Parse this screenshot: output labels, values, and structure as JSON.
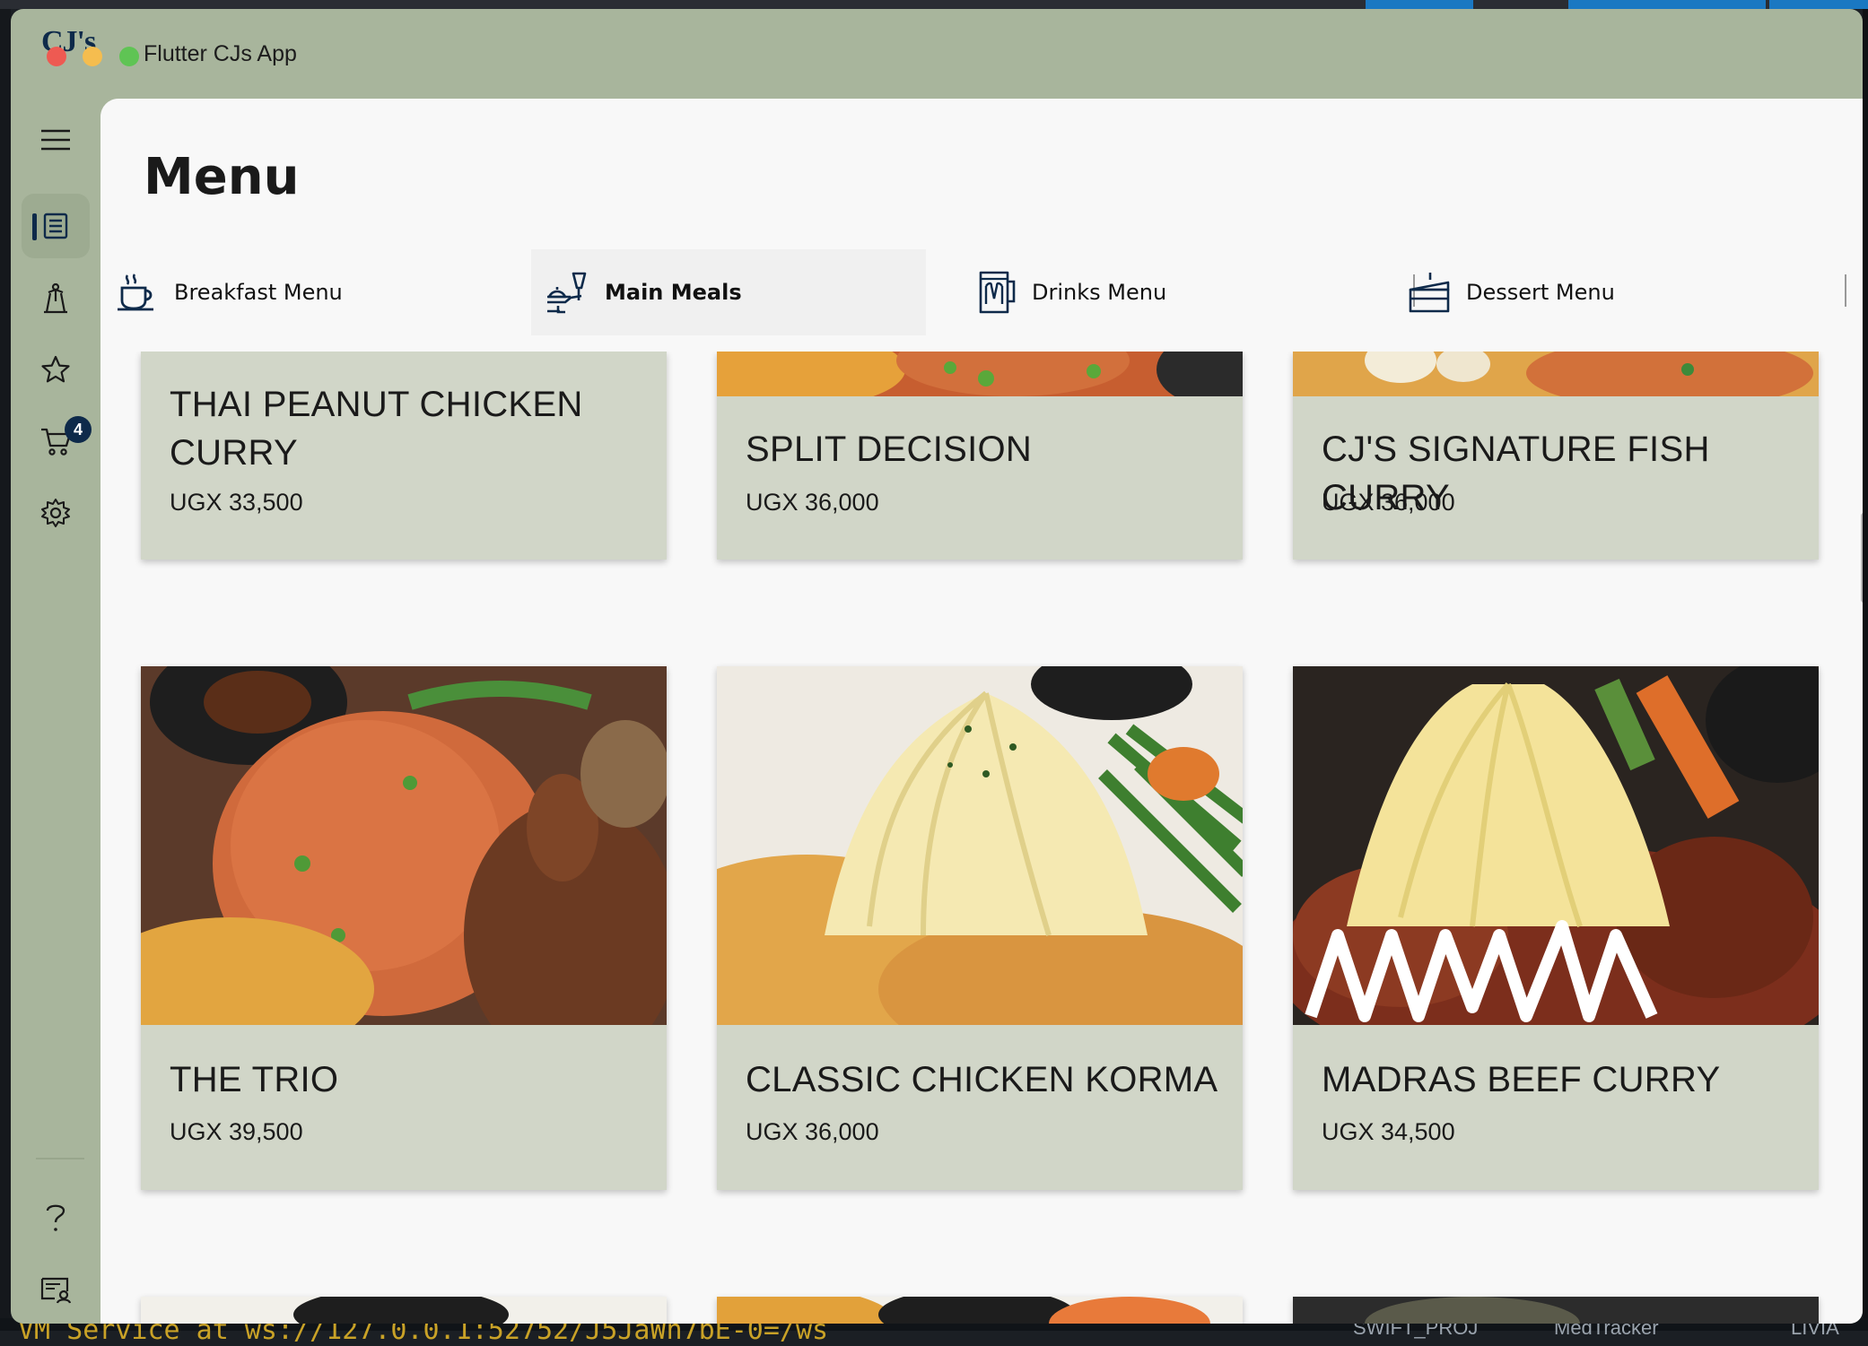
{
  "window": {
    "logo": "CJ's",
    "title": "Flutter CJs App"
  },
  "rail": {
    "items": [
      {
        "icon": "menu-hamburger-icon"
      },
      {
        "icon": "menu-list-icon",
        "active": true
      },
      {
        "icon": "waiter-icon"
      },
      {
        "icon": "star-icon"
      },
      {
        "icon": "cart-icon",
        "badge": "4"
      },
      {
        "icon": "gear-icon"
      },
      {
        "icon": "help-icon"
      },
      {
        "icon": "profile-icon"
      }
    ]
  },
  "page": {
    "title": "Menu"
  },
  "tabs": [
    {
      "label": "Breakfast Menu",
      "icon": "coffee-cup-icon"
    },
    {
      "label": "Main Meals",
      "icon": "meal-icon",
      "active": true
    },
    {
      "label": "Drinks Menu",
      "icon": "beer-mug-icon"
    },
    {
      "label": "Dessert Menu",
      "icon": "cake-icon"
    }
  ],
  "menu_items": [
    {
      "name": "THAI PEANUT CHICKEN CURRY",
      "price": "UGX 33,500"
    },
    {
      "name": "SPLIT DECISION",
      "price": "UGX 36,000"
    },
    {
      "name": "CJ'S SIGNATURE FISH CURRY",
      "price": "UGX 36,000"
    },
    {
      "name": "THE TRIO",
      "price": "UGX 39,500"
    },
    {
      "name": "CLASSIC CHICKEN KORMA",
      "price": "UGX 36,000"
    },
    {
      "name": "MADRAS BEEF CURRY",
      "price": "UGX 34,500"
    }
  ],
  "backdrop": {
    "terminal_text": "VM Service at ws://127.0.0.1:52752/J5JaWn7bE-0=/ws",
    "dock_items": [
      "SWIFT_PROJ",
      "MedTracker",
      "LIVIA"
    ]
  },
  "colors": {
    "window_bg": "#a8b59c",
    "content_bg": "#f8f8f8",
    "accent": "#0e2a4a",
    "card_info_bg": "#d0d6c8"
  }
}
